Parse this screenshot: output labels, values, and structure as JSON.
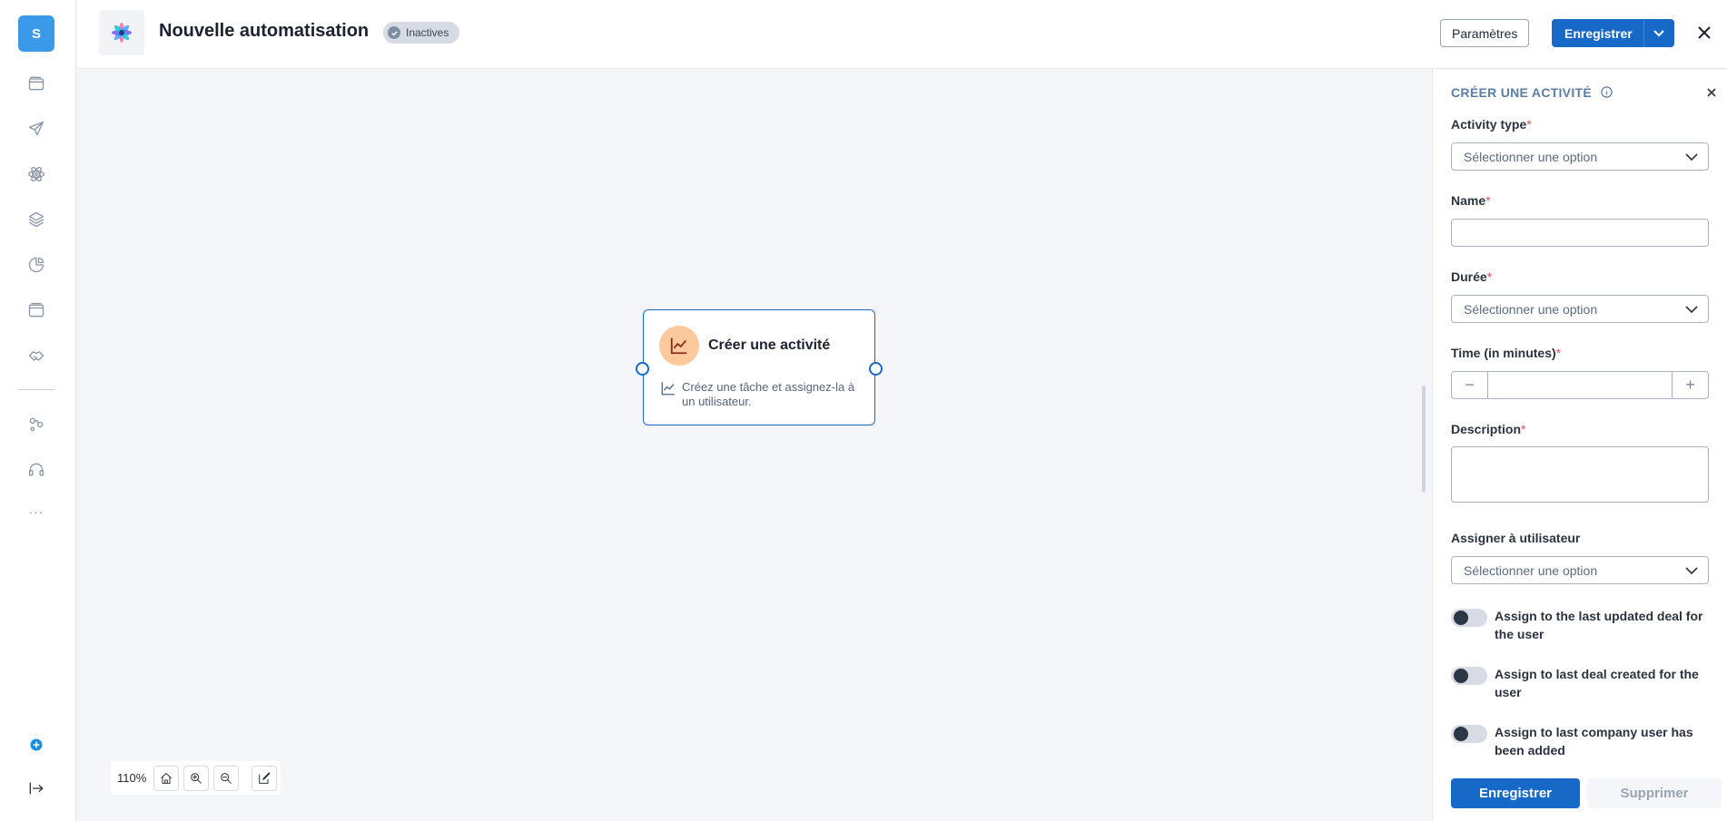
{
  "user": {
    "initial": "S"
  },
  "header": {
    "title": "Nouvelle automatisation",
    "status": "Inactives",
    "params_label": "Paramètres",
    "save_label": "Enregistrer"
  },
  "rail": {
    "items": [
      "wallet-icon",
      "send-icon",
      "atom-icon",
      "layers-icon",
      "pie-chart-icon",
      "browser-window-icon",
      "handshake-icon",
      "workflow-icon",
      "headset-icon"
    ],
    "more": "···"
  },
  "canvas": {
    "node": {
      "title": "Créer une activité",
      "description": "Créez une tâche et assignez-la à un utilisateur."
    },
    "zoom": "110%"
  },
  "panel": {
    "title": "CRÉER UNE ACTIVITÉ",
    "fields": {
      "activity_type": {
        "label": "Activity type",
        "placeholder": "Sélectionner une option"
      },
      "name": {
        "label": "Name",
        "value": ""
      },
      "duration": {
        "label": "Durée",
        "placeholder": "Sélectionner une option"
      },
      "time": {
        "label": "Time (in minutes)",
        "value": ""
      },
      "description": {
        "label": "Description",
        "value": ""
      },
      "assign_user": {
        "label": "Assigner à utilisateur",
        "placeholder": "Sélectionner une option"
      }
    },
    "required_mark": "*",
    "toggles": [
      {
        "label": "Assign to the last updated deal for the user",
        "on": false
      },
      {
        "label": "Assign to last deal created for the user",
        "on": false
      },
      {
        "label": "Assign to last company user has been added",
        "on": false
      }
    ],
    "submit_label": "Enregistrer",
    "delete_label": "Supprimer"
  },
  "colors": {
    "primary": "#1769c7",
    "node_badge": "#fbc99b",
    "required": "#e0524d"
  }
}
